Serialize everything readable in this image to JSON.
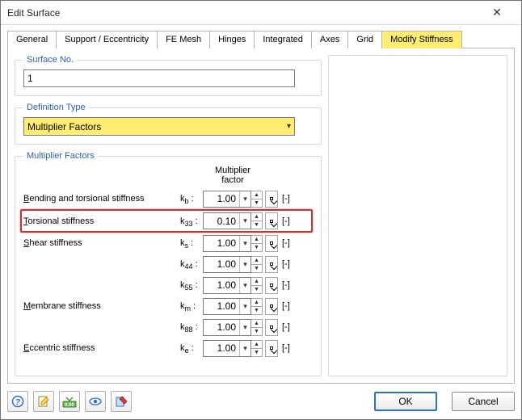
{
  "window": {
    "title": "Edit Surface"
  },
  "tabs": [
    {
      "label": "General"
    },
    {
      "label": "Support / Eccentricity"
    },
    {
      "label": "FE Mesh"
    },
    {
      "label": "Hinges"
    },
    {
      "label": "Integrated"
    },
    {
      "label": "Axes"
    },
    {
      "label": "Grid"
    },
    {
      "label": "Modify Stiffness",
      "active": true
    }
  ],
  "surface_no": {
    "legend": "Surface No.",
    "value": "1"
  },
  "definition": {
    "legend": "Definition Type",
    "value": "Multiplier Factors"
  },
  "mf": {
    "legend": "Multiplier Factors",
    "header": "Multiplier factor",
    "unit": "[-]",
    "rows": [
      {
        "label": "Bending and torsional stiffness",
        "sym": "k",
        "sub": "b",
        "value": "1.00"
      },
      {
        "label": "Torsional stiffness",
        "sym": "k",
        "sub": "33",
        "value": "0.10",
        "highlight": true
      },
      {
        "label": "Shear stiffness",
        "sym": "k",
        "sub": "s",
        "value": "1.00"
      },
      {
        "label": "",
        "sym": "k",
        "sub": "44",
        "value": "1.00"
      },
      {
        "label": "",
        "sym": "k",
        "sub": "55",
        "value": "1.00"
      },
      {
        "label": "Membrane stiffness",
        "sym": "k",
        "sub": "m",
        "value": "1.00"
      },
      {
        "label": "",
        "sym": "k",
        "sub": "88",
        "value": "1.00"
      },
      {
        "label": "Eccentric stiffness",
        "sym": "k",
        "sub": "e",
        "value": "1.00"
      }
    ]
  },
  "buttons": {
    "ok": "OK",
    "cancel": "Cancel"
  }
}
